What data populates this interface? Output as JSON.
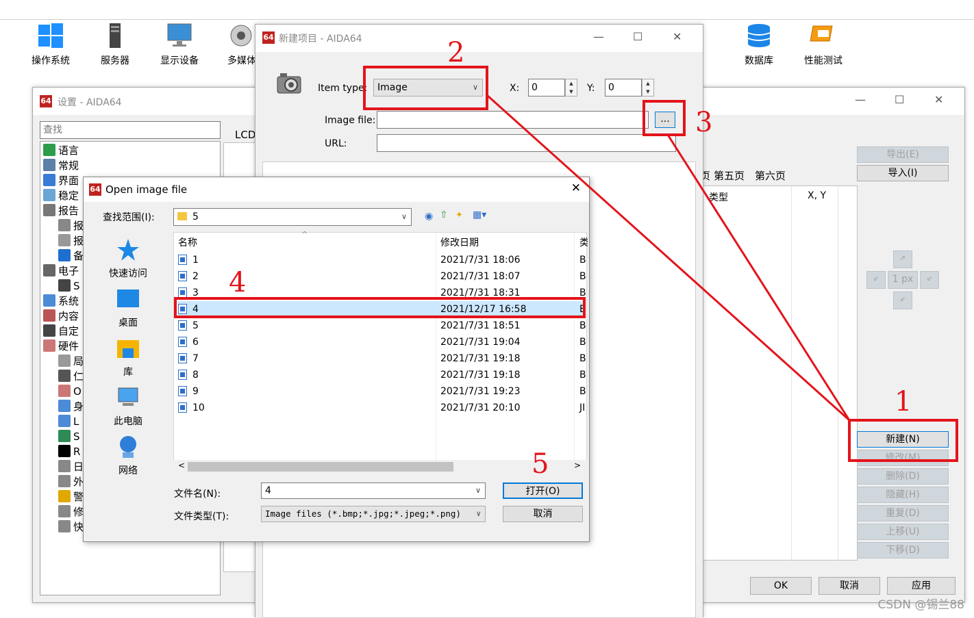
{
  "toolbar": {
    "items": [
      {
        "label": "操作系统",
        "icon": "windows-icon"
      },
      {
        "label": "服务器",
        "icon": "server-icon"
      },
      {
        "label": "显示设备",
        "icon": "monitor-icon"
      },
      {
        "label": "多媒体",
        "icon": "speaker-icon"
      },
      {
        "label": "数据库",
        "icon": "database-icon"
      },
      {
        "label": "性能测试",
        "icon": "benchmark-icon"
      }
    ]
  },
  "settings": {
    "title": "设置 - AIDA64",
    "logo": "64",
    "search_placeholder": "查找",
    "tree": [
      "语言",
      "常规",
      "界面",
      "稳定",
      "报告",
      "报",
      "报",
      "备",
      "电子",
      "S",
      "系统",
      "内容",
      "自定",
      "硬件",
      "局",
      "仁",
      "O",
      "身",
      "L",
      "S",
      "R",
      "日",
      "外",
      "警",
      "修正",
      "快捷键"
    ],
    "lcd_label": "LCD",
    "tabs": [
      "页",
      "第五页",
      "第六页"
    ],
    "columns": {
      "type": "类型",
      "xy": "X, Y"
    },
    "export_btn": "导出(E)",
    "import_btn": "导入(I)",
    "step_label": "1 px",
    "new_btn": "新建(N)",
    "modify_btn": "修改(M)",
    "delete_btn": "删除(D)",
    "hide_btn": "隐藏(H)",
    "duplicate_btn": "重复(D)",
    "up_btn": "上移(U)",
    "down_btn": "下移(D)",
    "ok_btn": "OK",
    "cancel_btn": "取消",
    "apply_btn": "应用"
  },
  "new_item": {
    "title": "新建项目 - AIDA64",
    "item_type_label": "Item type:",
    "item_type_value": "Image",
    "x_label": "X:",
    "x_value": "0",
    "y_label": "Y:",
    "y_value": "0",
    "image_file_label": "Image file:",
    "image_file_value": "",
    "browse_btn": "...",
    "url_label": "URL:",
    "url_value": ""
  },
  "file_dialog": {
    "title": "Open image file",
    "look_in_label": "查找范围(I):",
    "look_in_value": "5",
    "places": [
      "快速访问",
      "桌面",
      "库",
      "此电脑",
      "网络"
    ],
    "col_name": "名称",
    "col_date": "修改日期",
    "col_type": "类",
    "files": [
      {
        "name": "1",
        "date": "2021/7/31 18:06",
        "type": "B"
      },
      {
        "name": "2",
        "date": "2021/7/31 18:07",
        "type": "B"
      },
      {
        "name": "3",
        "date": "2021/7/31 18:31",
        "type": "B"
      },
      {
        "name": "4",
        "date": "2021/12/17 16:58",
        "type": "B"
      },
      {
        "name": "5",
        "date": "2021/7/31 18:51",
        "type": "B"
      },
      {
        "name": "6",
        "date": "2021/7/31 19:04",
        "type": "B"
      },
      {
        "name": "7",
        "date": "2021/7/31 19:18",
        "type": "B"
      },
      {
        "name": "8",
        "date": "2021/7/31 19:18",
        "type": "B"
      },
      {
        "name": "9",
        "date": "2021/7/31 19:23",
        "type": "B"
      },
      {
        "name": "10",
        "date": "2021/7/31 20:10",
        "type": "JI"
      }
    ],
    "selected_index": 3,
    "filename_label": "文件名(N):",
    "filename_value": "4",
    "filetype_label": "文件类型(T):",
    "filetype_value": "Image files (*.bmp;*.jpg;*.jpeg;*.png)",
    "open_btn": "打开(O)",
    "cancel_btn": "取消"
  },
  "annotations": [
    "1",
    "2",
    "3",
    "4",
    "5"
  ],
  "watermark": "CSDN @锡兰88",
  "colors": {
    "annotation_red": "#e3141b",
    "selection": "#cce8ff",
    "logo_red": "#c0231f"
  }
}
